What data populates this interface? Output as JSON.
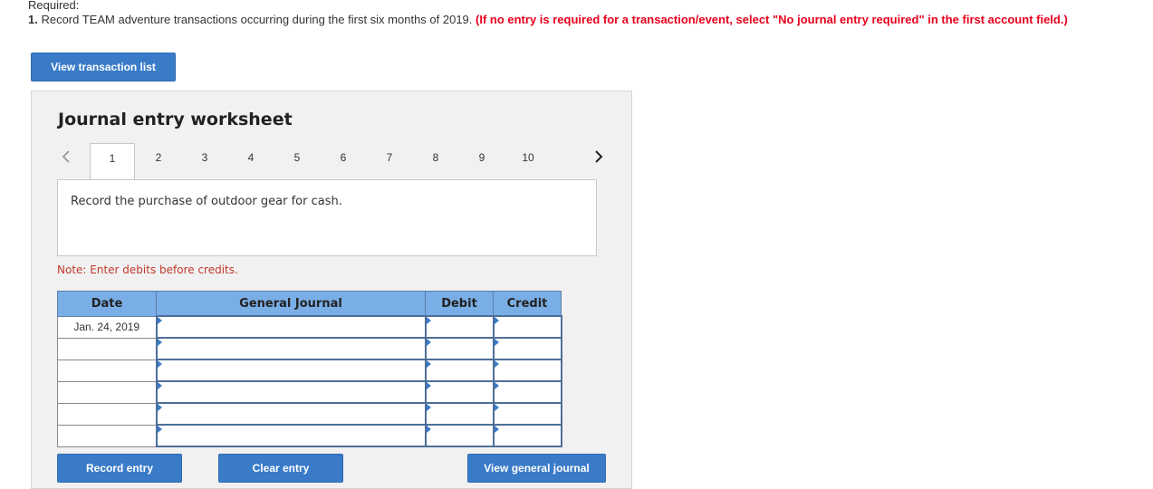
{
  "required": {
    "title": "Required:",
    "number": "1.",
    "instruction": " Record TEAM adventure transactions occurring during the first six months of 2019. ",
    "hint": "(If no entry is required for a transaction/event, select \"No journal entry required\" in the first account field.)"
  },
  "buttons": {
    "view_transaction_list": "View transaction list",
    "record_entry": "Record entry",
    "clear_entry": "Clear entry",
    "view_general_journal": "View general journal"
  },
  "worksheet": {
    "title": "Journal entry worksheet",
    "tabs": [
      "1",
      "2",
      "3",
      "4",
      "5",
      "6",
      "7",
      "8",
      "9",
      "10"
    ],
    "active_tab": "1",
    "description": "Record the purchase of outdoor gear for cash.",
    "note": "Note: Enter debits before credits."
  },
  "journal": {
    "headers": {
      "date": "Date",
      "general_journal": "General Journal",
      "debit": "Debit",
      "credit": "Credit"
    },
    "rows": [
      {
        "date": "Jan. 24, 2019",
        "account": "",
        "debit": "",
        "credit": ""
      },
      {
        "date": "",
        "account": "",
        "debit": "",
        "credit": ""
      },
      {
        "date": "",
        "account": "",
        "debit": "",
        "credit": ""
      },
      {
        "date": "",
        "account": "",
        "debit": "",
        "credit": ""
      },
      {
        "date": "",
        "account": "",
        "debit": "",
        "credit": ""
      },
      {
        "date": "",
        "account": "",
        "debit": "",
        "credit": ""
      }
    ]
  },
  "colors": {
    "button": "#3a7bc8",
    "header": "#7aaee6",
    "hint": "#e8001c"
  }
}
